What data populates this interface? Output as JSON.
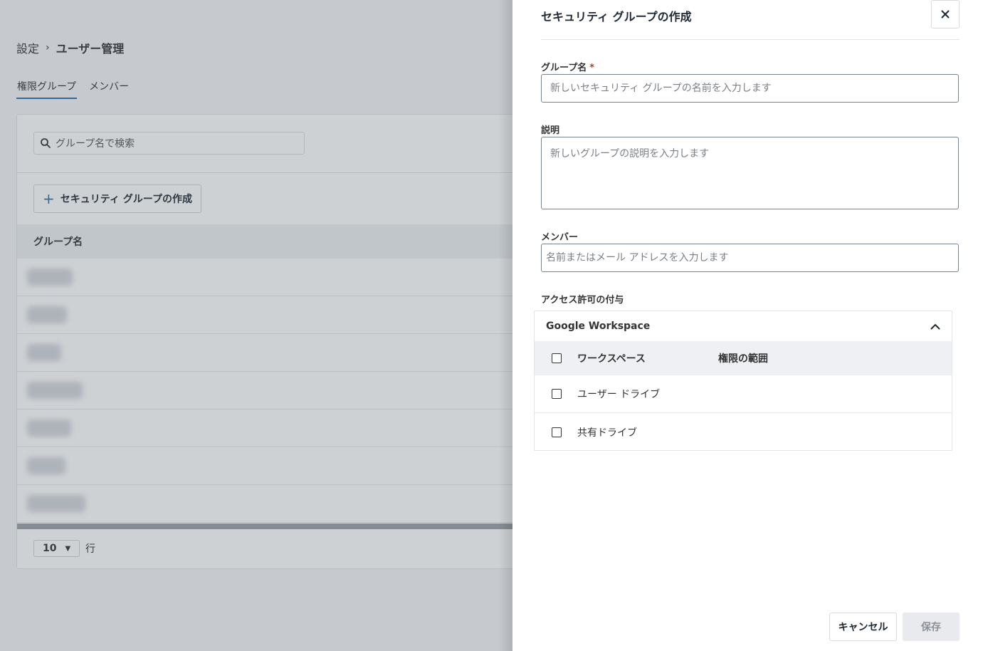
{
  "breadcrumb": {
    "parent": "設定",
    "current": "ユーザー管理"
  },
  "tabs": [
    {
      "label": "権限グループ",
      "active": true
    },
    {
      "label": "メンバー",
      "active": false
    }
  ],
  "search": {
    "placeholder": "グループ名で検索"
  },
  "create_button": {
    "label": "セキュリティ グループの作成"
  },
  "table": {
    "header_group_name": "グループ名",
    "row_count": 7
  },
  "pager": {
    "rows_value": "10",
    "rows_label": "行"
  },
  "drawer": {
    "title": "セキュリティ グループの作成",
    "group_name": {
      "label": "グループ名",
      "required_mark": "*",
      "placeholder": "新しいセキュリティ グループの名前を入力します"
    },
    "description": {
      "label": "説明",
      "placeholder": "新しいグループの説明を入力します"
    },
    "members": {
      "label": "メンバー",
      "placeholder": "名前またはメール アドレスを入力します"
    },
    "access": {
      "label": "アクセス許可の付与",
      "section_title": "Google Workspace",
      "columns": {
        "workspace": "ワークスペース",
        "scope": "権限の範囲"
      },
      "rows": [
        {
          "label": "ユーザー ドライブ"
        },
        {
          "label": "共有ドライブ"
        }
      ]
    },
    "cancel_label": "キャンセル",
    "save_label": "保存"
  },
  "colors": {
    "accent": "#2f6fa8",
    "required": "#d62b2b",
    "overlay": "rgba(80,90,100,0.28)"
  }
}
